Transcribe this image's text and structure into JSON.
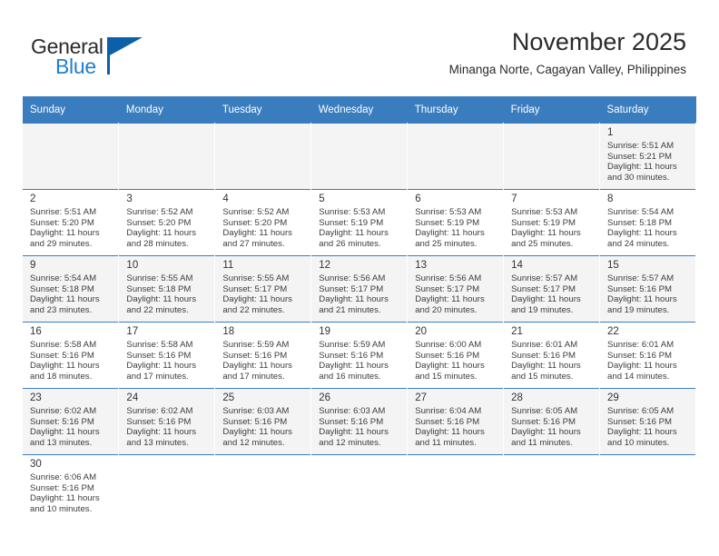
{
  "brand": {
    "name_top": "General",
    "name_bottom": "Blue",
    "color_dark": "#2b2b2b",
    "color_blue": "#1f7fd0",
    "mark_color": "#0c5fa8"
  },
  "header": {
    "title": "November 2025",
    "subtitle": "Minanga Norte, Cagayan Valley, Philippines"
  },
  "calendar": {
    "header_bg": "#3a7dbf",
    "header_text_color": "#ffffff",
    "shaded_row_bg": "#f4f4f4",
    "weekdays": [
      "Sunday",
      "Monday",
      "Tuesday",
      "Wednesday",
      "Thursday",
      "Friday",
      "Saturday"
    ],
    "weeks": [
      [
        {
          "empty": true
        },
        {
          "empty": true
        },
        {
          "empty": true
        },
        {
          "empty": true
        },
        {
          "empty": true
        },
        {
          "empty": true
        },
        {
          "day": "1",
          "sunrise": "Sunrise: 5:51 AM",
          "sunset": "Sunset: 5:21 PM",
          "daylight_1": "Daylight: 11 hours",
          "daylight_2": "and 30 minutes."
        }
      ],
      [
        {
          "day": "2",
          "sunrise": "Sunrise: 5:51 AM",
          "sunset": "Sunset: 5:20 PM",
          "daylight_1": "Daylight: 11 hours",
          "daylight_2": "and 29 minutes."
        },
        {
          "day": "3",
          "sunrise": "Sunrise: 5:52 AM",
          "sunset": "Sunset: 5:20 PM",
          "daylight_1": "Daylight: 11 hours",
          "daylight_2": "and 28 minutes."
        },
        {
          "day": "4",
          "sunrise": "Sunrise: 5:52 AM",
          "sunset": "Sunset: 5:20 PM",
          "daylight_1": "Daylight: 11 hours",
          "daylight_2": "and 27 minutes."
        },
        {
          "day": "5",
          "sunrise": "Sunrise: 5:53 AM",
          "sunset": "Sunset: 5:19 PM",
          "daylight_1": "Daylight: 11 hours",
          "daylight_2": "and 26 minutes."
        },
        {
          "day": "6",
          "sunrise": "Sunrise: 5:53 AM",
          "sunset": "Sunset: 5:19 PM",
          "daylight_1": "Daylight: 11 hours",
          "daylight_2": "and 25 minutes."
        },
        {
          "day": "7",
          "sunrise": "Sunrise: 5:53 AM",
          "sunset": "Sunset: 5:19 PM",
          "daylight_1": "Daylight: 11 hours",
          "daylight_2": "and 25 minutes."
        },
        {
          "day": "8",
          "sunrise": "Sunrise: 5:54 AM",
          "sunset": "Sunset: 5:18 PM",
          "daylight_1": "Daylight: 11 hours",
          "daylight_2": "and 24 minutes."
        }
      ],
      [
        {
          "day": "9",
          "sunrise": "Sunrise: 5:54 AM",
          "sunset": "Sunset: 5:18 PM",
          "daylight_1": "Daylight: 11 hours",
          "daylight_2": "and 23 minutes."
        },
        {
          "day": "10",
          "sunrise": "Sunrise: 5:55 AM",
          "sunset": "Sunset: 5:18 PM",
          "daylight_1": "Daylight: 11 hours",
          "daylight_2": "and 22 minutes."
        },
        {
          "day": "11",
          "sunrise": "Sunrise: 5:55 AM",
          "sunset": "Sunset: 5:17 PM",
          "daylight_1": "Daylight: 11 hours",
          "daylight_2": "and 22 minutes."
        },
        {
          "day": "12",
          "sunrise": "Sunrise: 5:56 AM",
          "sunset": "Sunset: 5:17 PM",
          "daylight_1": "Daylight: 11 hours",
          "daylight_2": "and 21 minutes."
        },
        {
          "day": "13",
          "sunrise": "Sunrise: 5:56 AM",
          "sunset": "Sunset: 5:17 PM",
          "daylight_1": "Daylight: 11 hours",
          "daylight_2": "and 20 minutes."
        },
        {
          "day": "14",
          "sunrise": "Sunrise: 5:57 AM",
          "sunset": "Sunset: 5:17 PM",
          "daylight_1": "Daylight: 11 hours",
          "daylight_2": "and 19 minutes."
        },
        {
          "day": "15",
          "sunrise": "Sunrise: 5:57 AM",
          "sunset": "Sunset: 5:16 PM",
          "daylight_1": "Daylight: 11 hours",
          "daylight_2": "and 19 minutes."
        }
      ],
      [
        {
          "day": "16",
          "sunrise": "Sunrise: 5:58 AM",
          "sunset": "Sunset: 5:16 PM",
          "daylight_1": "Daylight: 11 hours",
          "daylight_2": "and 18 minutes."
        },
        {
          "day": "17",
          "sunrise": "Sunrise: 5:58 AM",
          "sunset": "Sunset: 5:16 PM",
          "daylight_1": "Daylight: 11 hours",
          "daylight_2": "and 17 minutes."
        },
        {
          "day": "18",
          "sunrise": "Sunrise: 5:59 AM",
          "sunset": "Sunset: 5:16 PM",
          "daylight_1": "Daylight: 11 hours",
          "daylight_2": "and 17 minutes."
        },
        {
          "day": "19",
          "sunrise": "Sunrise: 5:59 AM",
          "sunset": "Sunset: 5:16 PM",
          "daylight_1": "Daylight: 11 hours",
          "daylight_2": "and 16 minutes."
        },
        {
          "day": "20",
          "sunrise": "Sunrise: 6:00 AM",
          "sunset": "Sunset: 5:16 PM",
          "daylight_1": "Daylight: 11 hours",
          "daylight_2": "and 15 minutes."
        },
        {
          "day": "21",
          "sunrise": "Sunrise: 6:01 AM",
          "sunset": "Sunset: 5:16 PM",
          "daylight_1": "Daylight: 11 hours",
          "daylight_2": "and 15 minutes."
        },
        {
          "day": "22",
          "sunrise": "Sunrise: 6:01 AM",
          "sunset": "Sunset: 5:16 PM",
          "daylight_1": "Daylight: 11 hours",
          "daylight_2": "and 14 minutes."
        }
      ],
      [
        {
          "day": "23",
          "sunrise": "Sunrise: 6:02 AM",
          "sunset": "Sunset: 5:16 PM",
          "daylight_1": "Daylight: 11 hours",
          "daylight_2": "and 13 minutes."
        },
        {
          "day": "24",
          "sunrise": "Sunrise: 6:02 AM",
          "sunset": "Sunset: 5:16 PM",
          "daylight_1": "Daylight: 11 hours",
          "daylight_2": "and 13 minutes."
        },
        {
          "day": "25",
          "sunrise": "Sunrise: 6:03 AM",
          "sunset": "Sunset: 5:16 PM",
          "daylight_1": "Daylight: 11 hours",
          "daylight_2": "and 12 minutes."
        },
        {
          "day": "26",
          "sunrise": "Sunrise: 6:03 AM",
          "sunset": "Sunset: 5:16 PM",
          "daylight_1": "Daylight: 11 hours",
          "daylight_2": "and 12 minutes."
        },
        {
          "day": "27",
          "sunrise": "Sunrise: 6:04 AM",
          "sunset": "Sunset: 5:16 PM",
          "daylight_1": "Daylight: 11 hours",
          "daylight_2": "and 11 minutes."
        },
        {
          "day": "28",
          "sunrise": "Sunrise: 6:05 AM",
          "sunset": "Sunset: 5:16 PM",
          "daylight_1": "Daylight: 11 hours",
          "daylight_2": "and 11 minutes."
        },
        {
          "day": "29",
          "sunrise": "Sunrise: 6:05 AM",
          "sunset": "Sunset: 5:16 PM",
          "daylight_1": "Daylight: 11 hours",
          "daylight_2": "and 10 minutes."
        }
      ],
      [
        {
          "day": "30",
          "sunrise": "Sunrise: 6:06 AM",
          "sunset": "Sunset: 5:16 PM",
          "daylight_1": "Daylight: 11 hours",
          "daylight_2": "and 10 minutes."
        },
        {
          "empty": true
        },
        {
          "empty": true
        },
        {
          "empty": true
        },
        {
          "empty": true
        },
        {
          "empty": true
        },
        {
          "empty": true
        }
      ]
    ]
  }
}
